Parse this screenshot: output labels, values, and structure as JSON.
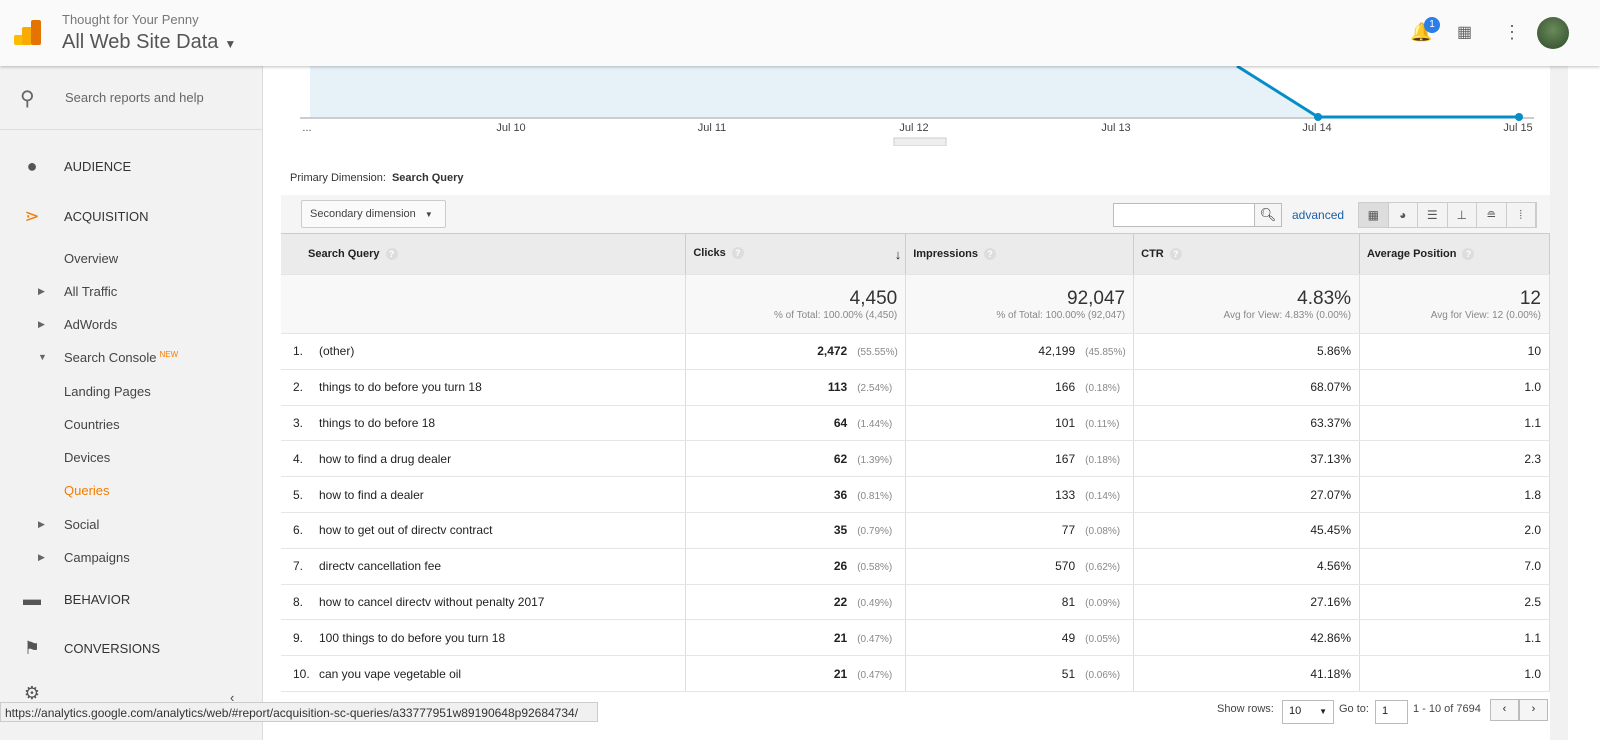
{
  "header": {
    "account": "Thought for Your Penny",
    "property": "All Web Site Data",
    "notification_count": "1"
  },
  "sidebar": {
    "search_placeholder": "Search reports and help",
    "sections": [
      {
        "label": "AUDIENCE",
        "icon": "person-icon"
      },
      {
        "label": "ACQUISITION",
        "icon": "acquisition-icon"
      },
      {
        "label": "BEHAVIOR",
        "icon": "behavior-icon"
      },
      {
        "label": "CONVERSIONS",
        "icon": "flag-icon"
      }
    ],
    "acq_items": {
      "overview": "Overview",
      "all_traffic": "All Traffic",
      "adwords": "AdWords",
      "search_console": "Search Console",
      "new_badge": "NEW",
      "landing_pages": "Landing Pages",
      "countries": "Countries",
      "devices": "Devices",
      "queries": "Queries",
      "social": "Social",
      "campaigns": "Campaigns"
    },
    "active_color": "#f57c00"
  },
  "chart": {
    "x_labels": [
      "...",
      "Jul 10",
      "Jul 11",
      "Jul 12",
      "Jul 13",
      "Jul 14",
      "Jul 15"
    ],
    "line_color": "#058dc7"
  },
  "report": {
    "primary_dimension_label": "Primary Dimension:",
    "primary_dimension": "Search Query",
    "secondary_dimension": "Secondary dimension",
    "advanced": "advanced",
    "columns": [
      "Search Query",
      "Clicks",
      "Impressions",
      "CTR",
      "Average Position"
    ],
    "totals": {
      "clicks": "4,450",
      "clicks_sub": "% of Total: 100.00% (4,450)",
      "impressions": "92,047",
      "impressions_sub": "% of Total: 100.00% (92,047)",
      "ctr": "4.83%",
      "ctr_sub": "Avg for View: 4.83% (0.00%)",
      "position": "12",
      "position_sub": "Avg for View: 12 (0.00%)"
    },
    "rows": [
      {
        "idx": "1.",
        "query": "(other)",
        "clicks": "2,472",
        "clicks_pct": "(55.55%)",
        "impr": "42,199",
        "impr_pct": "(45.85%)",
        "ctr": "5.86%",
        "pos": "10"
      },
      {
        "idx": "2.",
        "query": "things to do before you turn 18",
        "clicks": "113",
        "clicks_pct": "(2.54%)",
        "impr": "166",
        "impr_pct": "(0.18%)",
        "ctr": "68.07%",
        "pos": "1.0"
      },
      {
        "idx": "3.",
        "query": "things to do before 18",
        "clicks": "64",
        "clicks_pct": "(1.44%)",
        "impr": "101",
        "impr_pct": "(0.11%)",
        "ctr": "63.37%",
        "pos": "1.1"
      },
      {
        "idx": "4.",
        "query": "how to find a drug dealer",
        "clicks": "62",
        "clicks_pct": "(1.39%)",
        "impr": "167",
        "impr_pct": "(0.18%)",
        "ctr": "37.13%",
        "pos": "2.3"
      },
      {
        "idx": "5.",
        "query": "how to find a dealer",
        "clicks": "36",
        "clicks_pct": "(0.81%)",
        "impr": "133",
        "impr_pct": "(0.14%)",
        "ctr": "27.07%",
        "pos": "1.8"
      },
      {
        "idx": "6.",
        "query": "how to get out of directv contract",
        "clicks": "35",
        "clicks_pct": "(0.79%)",
        "impr": "77",
        "impr_pct": "(0.08%)",
        "ctr": "45.45%",
        "pos": "2.0"
      },
      {
        "idx": "7.",
        "query": "directv cancellation fee",
        "clicks": "26",
        "clicks_pct": "(0.58%)",
        "impr": "570",
        "impr_pct": "(0.62%)",
        "ctr": "4.56%",
        "pos": "7.0"
      },
      {
        "idx": "8.",
        "query": "how to cancel directv without penalty 2017",
        "clicks": "22",
        "clicks_pct": "(0.49%)",
        "impr": "81",
        "impr_pct": "(0.09%)",
        "ctr": "27.16%",
        "pos": "2.5"
      },
      {
        "idx": "9.",
        "query": "100 things to do before you turn 18",
        "clicks": "21",
        "clicks_pct": "(0.47%)",
        "impr": "49",
        "impr_pct": "(0.05%)",
        "ctr": "42.86%",
        "pos": "1.1"
      },
      {
        "idx": "10.",
        "query": "can you vape vegetable oil",
        "clicks": "21",
        "clicks_pct": "(0.47%)",
        "impr": "51",
        "impr_pct": "(0.06%)",
        "ctr": "41.18%",
        "pos": "1.0"
      }
    ]
  },
  "pager": {
    "show_rows_label": "Show rows:",
    "show_rows": "10",
    "goto_label": "Go to:",
    "goto": "1",
    "range": "1 - 10 of 7694"
  },
  "status_url": "https://analytics.google.com/analytics/web/#report/acquisition-sc-queries/a33777951w89190648p92684734/"
}
